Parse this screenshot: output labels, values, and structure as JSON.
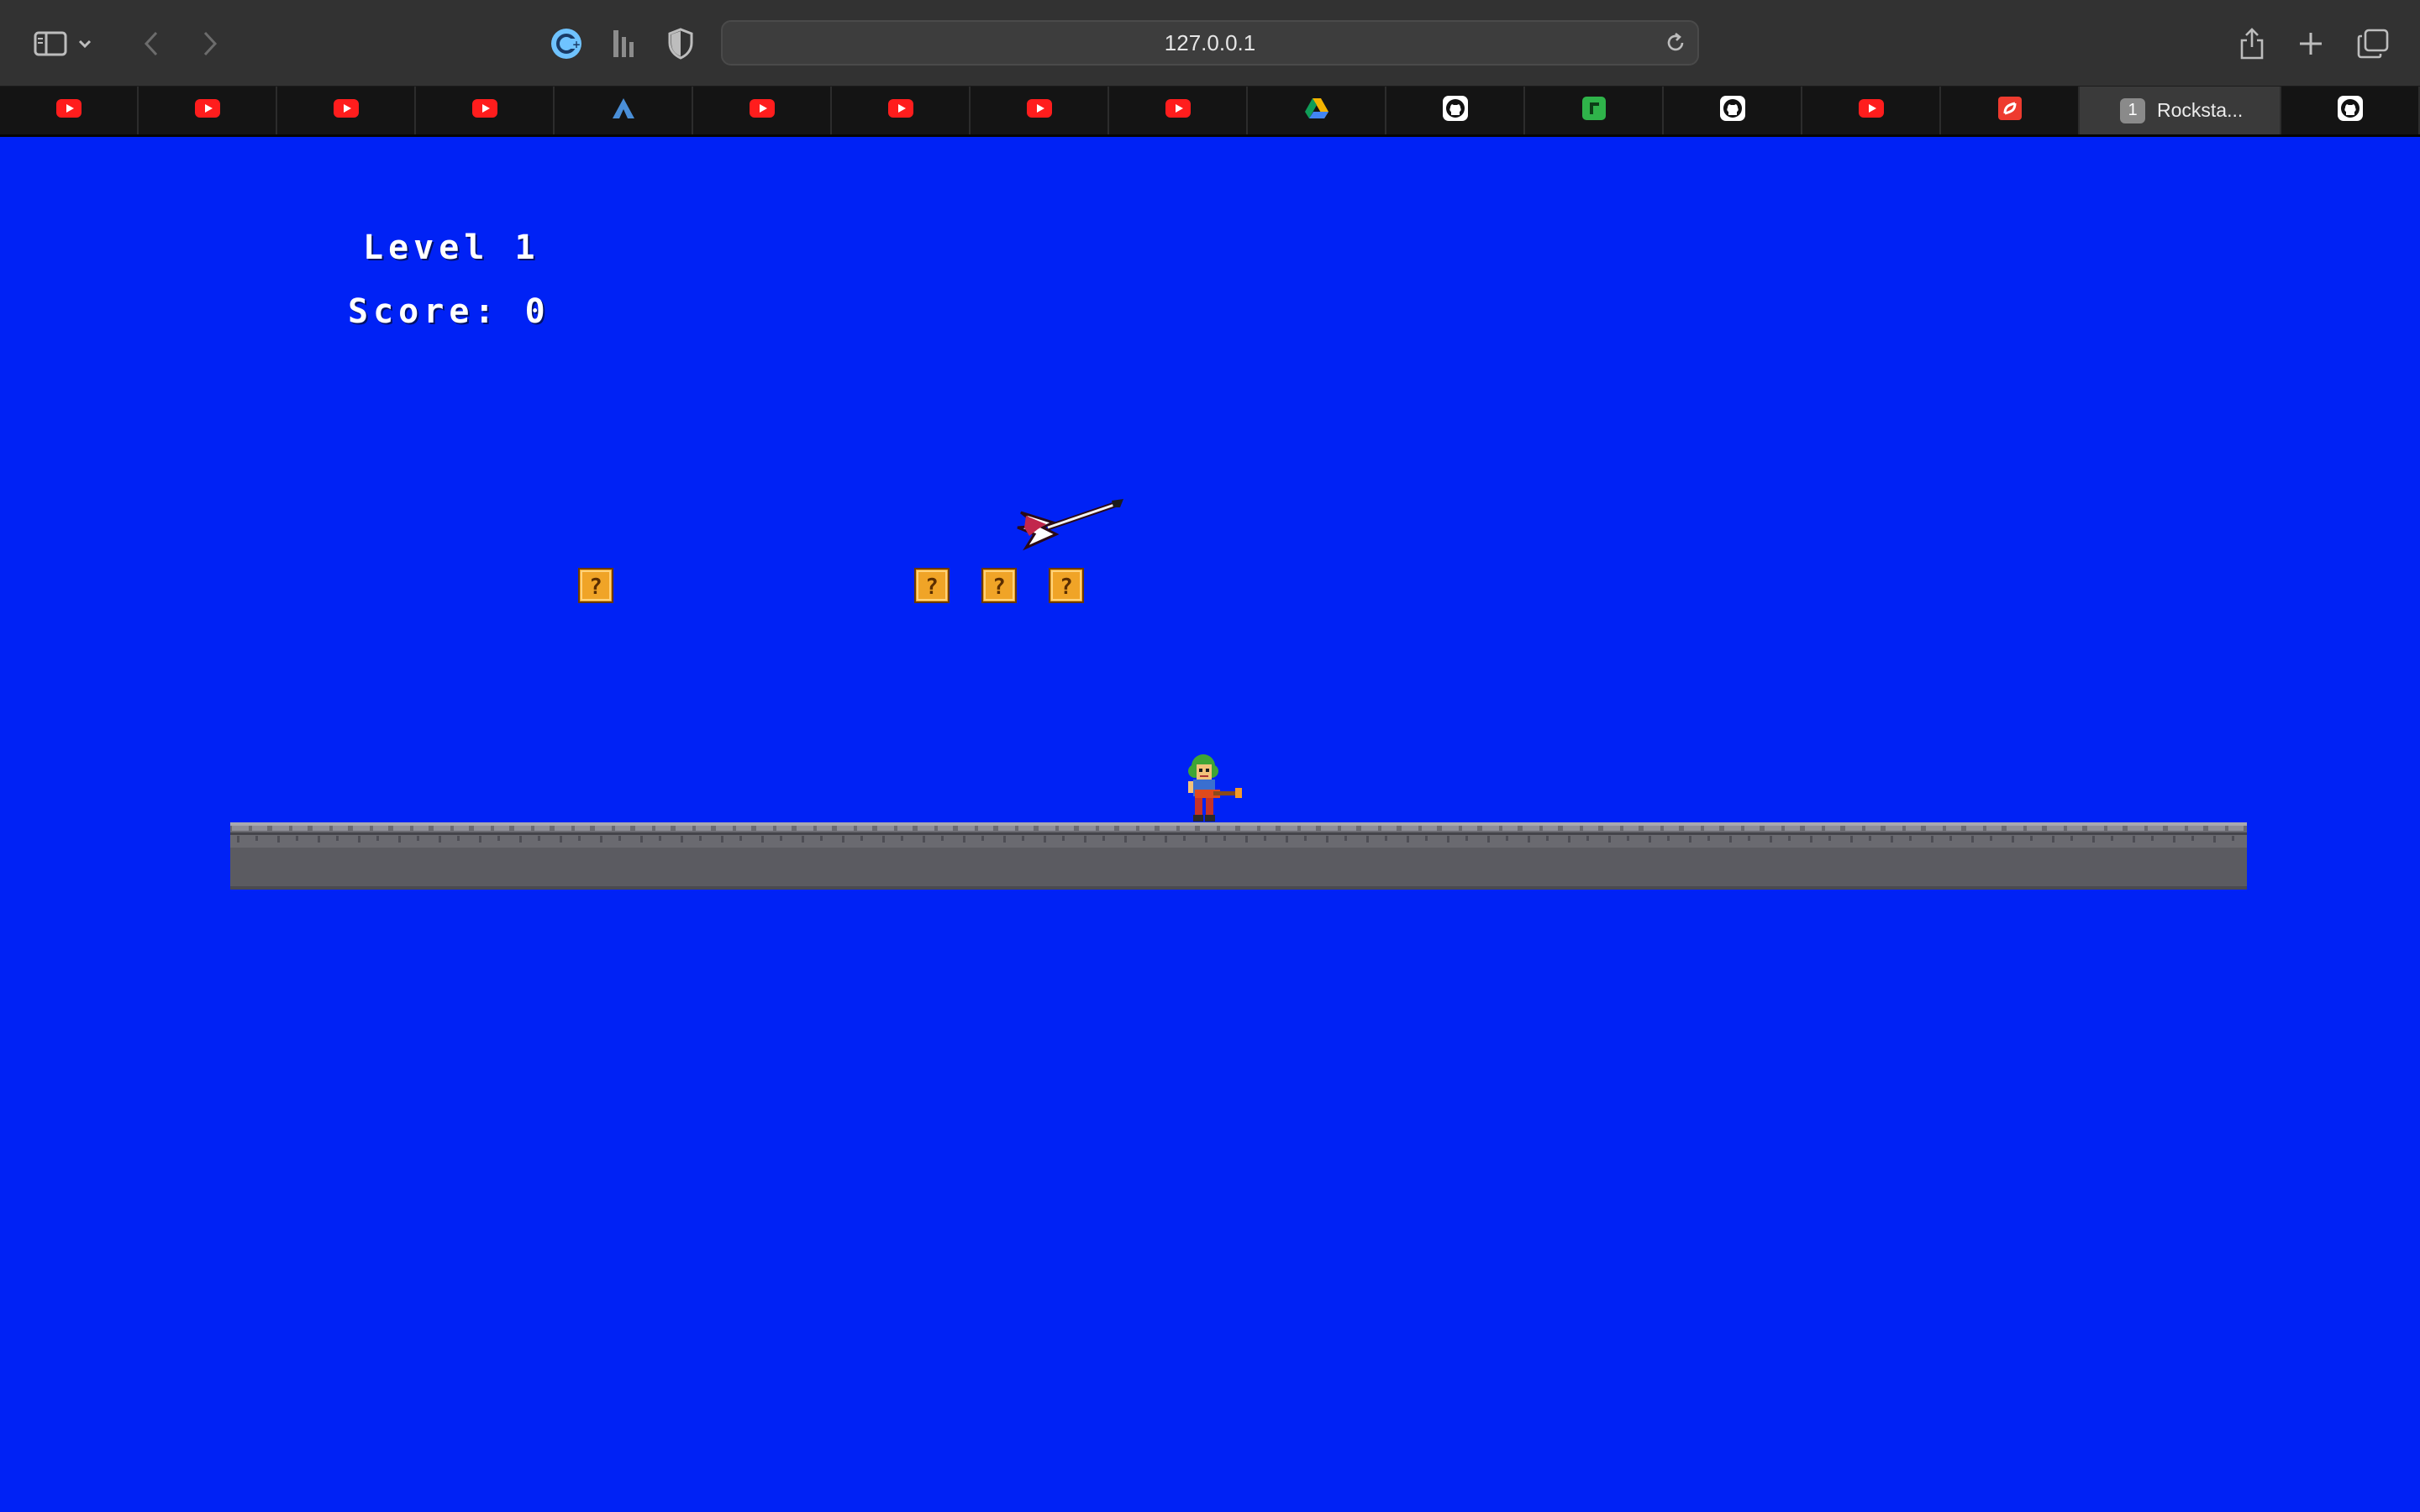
{
  "browser": {
    "url": "127.0.0.1",
    "tabs": [
      {
        "icon": "youtube-icon"
      },
      {
        "icon": "youtube-icon"
      },
      {
        "icon": "youtube-icon"
      },
      {
        "icon": "youtube-icon"
      },
      {
        "icon": "arch-icon"
      },
      {
        "icon": "youtube-icon"
      },
      {
        "icon": "youtube-icon"
      },
      {
        "icon": "youtube-icon"
      },
      {
        "icon": "youtube-icon"
      },
      {
        "icon": "google-drive-icon"
      },
      {
        "icon": "github-icon"
      },
      {
        "icon": "green-app-icon"
      },
      {
        "icon": "github-icon"
      },
      {
        "icon": "youtube-icon"
      },
      {
        "icon": "red-app-icon"
      },
      {
        "icon": "tab-badge",
        "badge": "1",
        "title": "Rocksta...",
        "active": true
      },
      {
        "icon": "github-icon"
      }
    ]
  },
  "game": {
    "background_color": "#0022f5",
    "hud": {
      "level_text": "Level 1",
      "score_text": "Score: 0"
    },
    "question_blocks_count": 4,
    "ground_color": "#5b5b61"
  }
}
